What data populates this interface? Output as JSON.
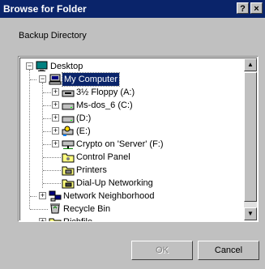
{
  "window": {
    "title": "Browse for Folder",
    "help_glyph": "?",
    "close_glyph": "×"
  },
  "prompt": "Backup Directory",
  "tree": [
    {
      "label": "Desktop",
      "icon": "desktop-icon",
      "expander": "−"
    },
    {
      "label": "My Computer",
      "icon": "my-computer-icon",
      "expander": "−",
      "selected": true
    },
    {
      "label": "3½ Floppy (A:)",
      "icon": "floppy-drive-icon",
      "expander": "+"
    },
    {
      "label": "Ms-dos_6 (C:)",
      "icon": "hard-drive-icon",
      "expander": "+"
    },
    {
      "label": "(D:)",
      "icon": "hard-drive-icon",
      "expander": "+"
    },
    {
      "label": "(E:)",
      "icon": "shared-drive-icon",
      "expander": "+"
    },
    {
      "label": "Crypto on 'Server' (F:)",
      "icon": "network-drive-icon",
      "expander": "+"
    },
    {
      "label": "Control Panel",
      "icon": "control-panel-icon"
    },
    {
      "label": "Printers",
      "icon": "printers-icon"
    },
    {
      "label": "Dial-Up Networking",
      "icon": "dialup-networking-icon"
    },
    {
      "label": "Network Neighborhood",
      "icon": "network-neighborhood-icon",
      "expander": "+"
    },
    {
      "label": "Recycle Bin",
      "icon": "recycle-bin-icon"
    },
    {
      "label": "Richfile",
      "icon": "folder-icon",
      "expander": "+"
    }
  ],
  "buttons": {
    "ok": "OK",
    "cancel": "Cancel"
  }
}
